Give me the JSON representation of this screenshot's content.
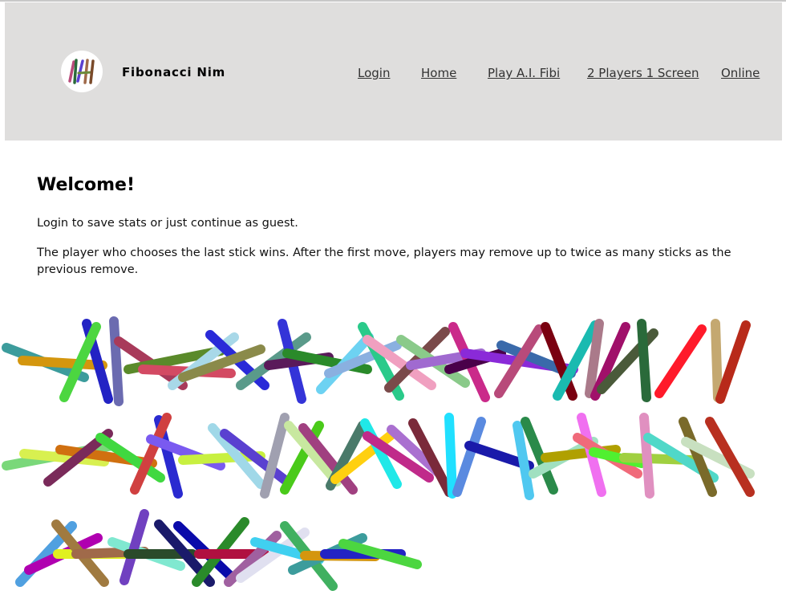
{
  "header": {
    "brand": "Fibonacci Nim",
    "logo_icon": "sticks-logo-icon",
    "nav": [
      {
        "label": "Login"
      },
      {
        "label": "Home"
      },
      {
        "label": "Play A.I. Fibi"
      },
      {
        "label": "2 Players 1 Screen"
      },
      {
        "label": "Online"
      }
    ]
  },
  "main": {
    "title": "Welcome!",
    "intro": "Login to save stats or just continue as guest.",
    "rules": "The player who chooses the last stick wins. After the first move, players may remove up to twice as many sticks as the previous remove."
  },
  "sticks": {
    "count": 68,
    "colors": [
      "#3c9c9c",
      "#d4960e",
      "#2323c4",
      "#4cd640",
      "#6b6bb0",
      "#a83a5a",
      "#5a8a2a",
      "#d34a63",
      "#a8d8e8",
      "#2a2ad8",
      "#8a8a4a",
      "#5a9a8a",
      "#3434d8",
      "#5a1a5a",
      "#2a8a2a",
      "#6dd2f2",
      "#8ab0e0",
      "#2aca8a",
      "#f0a0c0",
      "#7a4a4a",
      "#8aca8a",
      "#a06ad0",
      "#ca2a8a",
      "#4a004a",
      "#8a2ad8",
      "#3a6aaa",
      "#b84a7a",
      "#7a0010",
      "#1abab0",
      "#aa7a8a",
      "#a0106a",
      "#4a5a3a",
      "#2a6a3a",
      "#ff1a2a",
      "#c4a870",
      "#b82a1a",
      "#7ad87a",
      "#d8f050",
      "#d07010",
      "#7a2a5a",
      "#40d840",
      "#2a2ad0",
      "#d04040",
      "#7a5af0",
      "#c8f040",
      "#a0d8e8",
      "#5a40d0",
      "#a0a0b0",
      "#4aca1a",
      "#c8e8a0",
      "#a04080",
      "#4a7a6a",
      "#ffd010",
      "#20e8e8",
      "#c02a8a",
      "#aa70d0",
      "#7a2a3a",
      "#20e0ff",
      "#5a8ae0",
      "#1a1aaa",
      "#50c8f0",
      "#2a8a4a",
      "#a0e0c0",
      "#b0a000",
      "#f070f0",
      "#f06a7a",
      "#50f030",
      "#a0d040",
      "#e090c0",
      "#50d8c8",
      "#7a6a2a",
      "#c8e0c0",
      "#b83020",
      "#50a0e0",
      "#b000b0",
      "#e0f020",
      "#a07a40",
      "#a06a4a",
      "#80e8d0",
      "#7040c0",
      "#2a4a2a",
      "#1a1a6a",
      "#0a0aaa",
      "#2a8a2a",
      "#b01040",
      "#a060a0",
      "#e0e0f0",
      "#40d0f0",
      "#40b060"
    ]
  }
}
